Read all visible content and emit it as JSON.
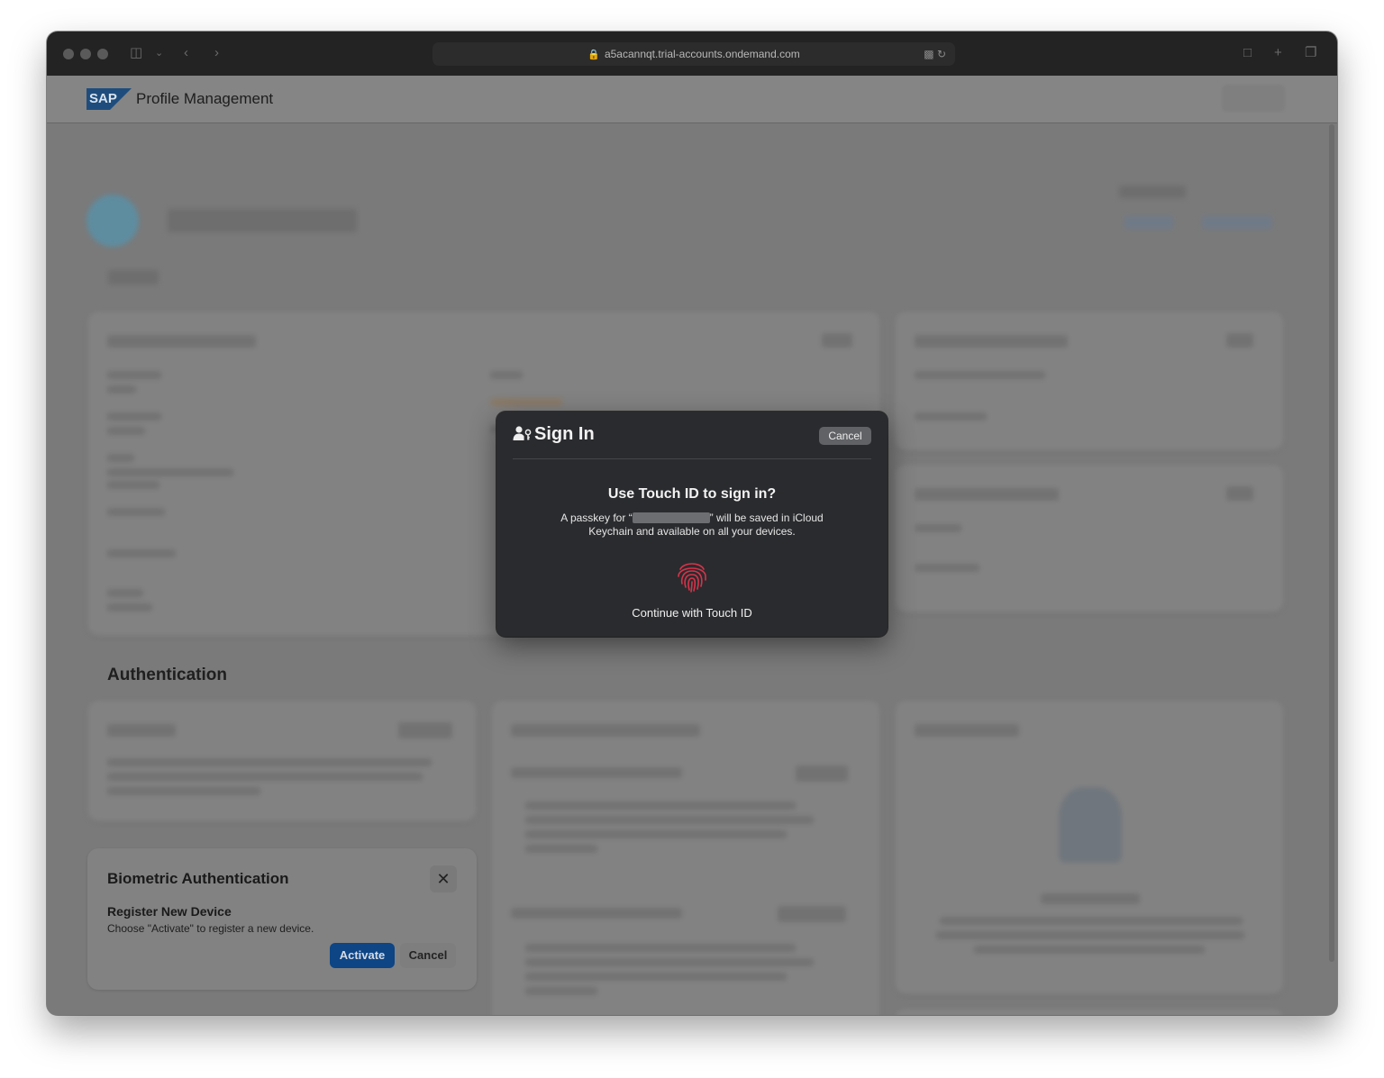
{
  "browser": {
    "url": "a5acannqt.trial-accounts.ondemand.com"
  },
  "app": {
    "brand": "SAP",
    "title": "Profile Management"
  },
  "sections": {
    "authentication": "Authentication"
  },
  "biometric_card": {
    "title": "Biometric Authentication",
    "subtitle": "Register New Device",
    "description": "Choose \"Activate\" to register a new device.",
    "activate_label": "Activate",
    "cancel_label": "Cancel",
    "close_glyph": "✕"
  },
  "passkey_dialog": {
    "title": "Sign In",
    "cancel_label": "Cancel",
    "heading": "Use Touch ID to sign in?",
    "body_prefix": "A passkey for “",
    "body_suffix": "” will be saved in iCloud Keychain and available on all your devices.",
    "continue_label": "Continue with Touch ID",
    "icons": [
      "person-key-icon",
      "fingerprint-icon"
    ]
  },
  "colors": {
    "sap_blue": "#0d4585",
    "fingerprint": "#d8334a",
    "dialog_bg": "#2a2b2e"
  }
}
